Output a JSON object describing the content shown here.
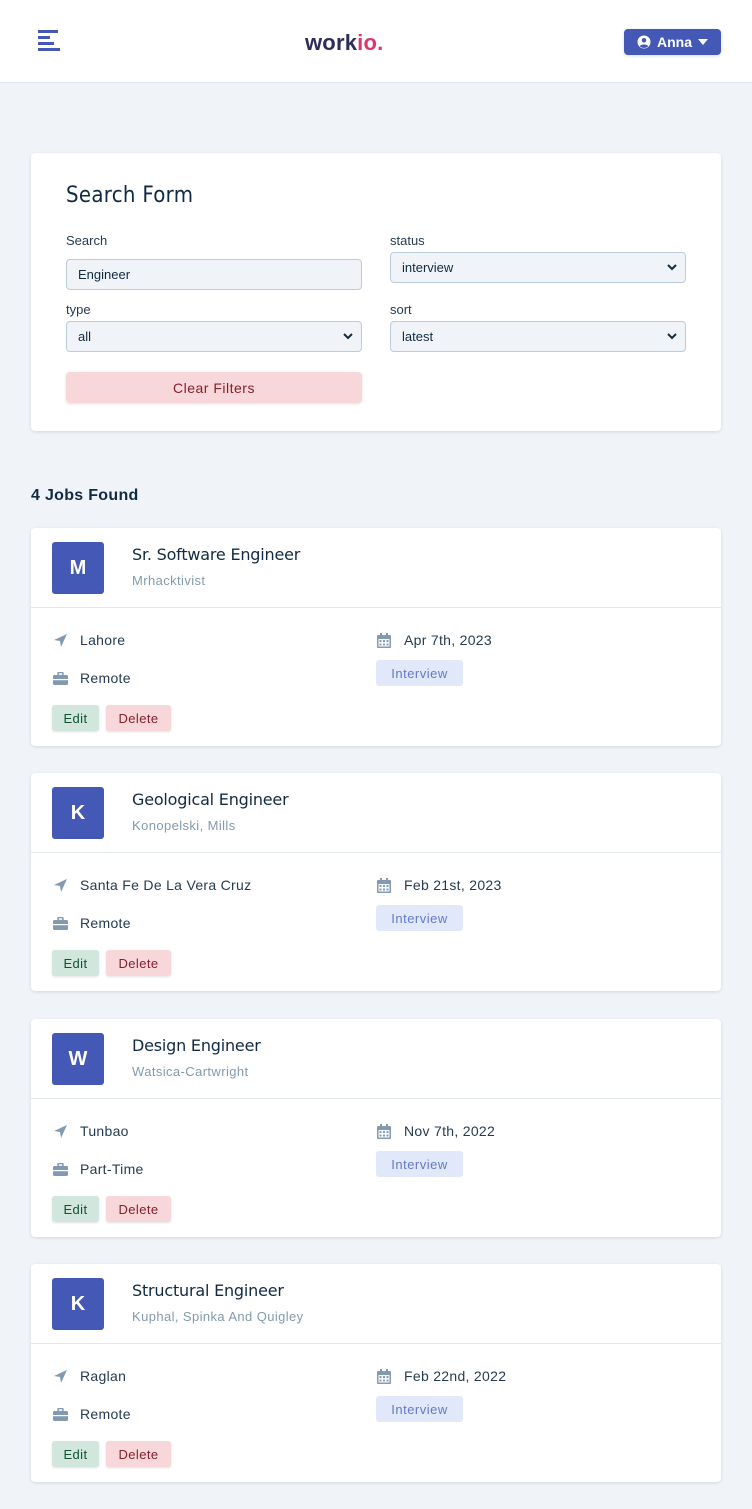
{
  "navbar": {
    "logo_text": "work",
    "logo_accent": "io.",
    "user_name": "Anna",
    "brand_color": "#4459b5",
    "accent_color": "#e0356a"
  },
  "search_form": {
    "title": "Search Form",
    "search_label": "Search",
    "search_value": "Engineer",
    "status_label": "status",
    "status_value": "interview",
    "type_label": "type",
    "type_value": "all",
    "sort_label": "sort",
    "sort_value": "latest",
    "clear_label": "Clear Filters"
  },
  "jobs_found": "4 Jobs Found",
  "jobs": [
    {
      "letter": "M",
      "position": "Sr. Software Engineer",
      "company": "Mrhacktivist",
      "location": "Lahore",
      "type": "Remote",
      "date": "Apr 7th, 2023",
      "status": "Interview",
      "edit": "Edit",
      "delete": "Delete"
    },
    {
      "letter": "K",
      "position": "Geological Engineer",
      "company": "Konopelski, Mills",
      "location": "Santa Fe De La Vera Cruz",
      "type": "Remote",
      "date": "Feb 21st, 2023",
      "status": "Interview",
      "edit": "Edit",
      "delete": "Delete"
    },
    {
      "letter": "W",
      "position": "Design Engineer",
      "company": "Watsica-Cartwright",
      "location": "Tunbao",
      "type": "Part-Time",
      "date": "Nov 7th, 2022",
      "status": "Interview",
      "edit": "Edit",
      "delete": "Delete"
    },
    {
      "letter": "K",
      "position": "Structural Engineer",
      "company": "Kuphal, Spinka And Quigley",
      "location": "Raglan",
      "type": "Remote",
      "date": "Feb 22nd, 2022",
      "status": "Interview",
      "edit": "Edit",
      "delete": "Delete"
    }
  ]
}
